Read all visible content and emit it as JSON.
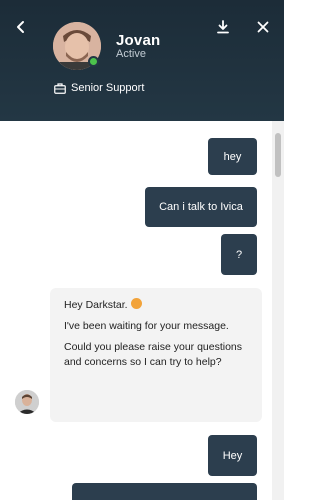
{
  "header": {
    "agent_name": "Jovan",
    "agent_status": "Active",
    "team_label": "Senior Support",
    "online_color": "#4cc34c"
  },
  "messages": [
    {
      "from": "user",
      "text": "hey"
    },
    {
      "from": "user",
      "text": "Can i talk to Ivica"
    },
    {
      "from": "user",
      "text": "?"
    },
    {
      "from": "agent",
      "lines": [
        "Hey Darkstar.",
        "I've been waiting for your message.",
        "Could you please raise your questions and concerns so I can try to help?"
      ]
    },
    {
      "from": "user",
      "text": "Hey"
    },
    {
      "from": "user",
      "text": ""
    }
  ],
  "icons": {
    "back": "chevron-left-icon",
    "download": "download-icon",
    "close": "close-icon",
    "team": "briefcase-icon",
    "emoji": "smiling-face-emoji"
  },
  "colors": {
    "header_bg": "#1c2c38",
    "user_bubble": "#2c3e4e",
    "agent_bubble": "#f3f3f3"
  }
}
